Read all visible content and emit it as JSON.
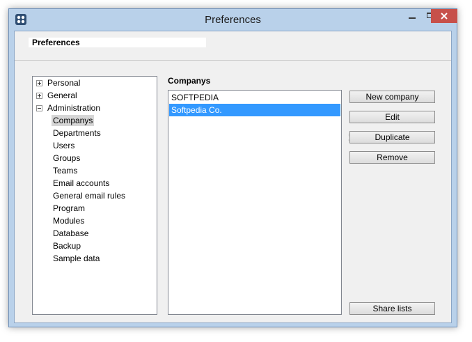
{
  "window": {
    "title": "Preferences",
    "colors": {
      "frame": "#b9d1ea",
      "close": "#c7504a",
      "selection": "#3399ff"
    }
  },
  "icons": [
    "app-icon",
    "minimize-icon",
    "maximize-icon",
    "close-icon",
    "expand-icon",
    "collapse-icon"
  ],
  "header": {
    "title": "Preferences"
  },
  "tree": {
    "nodes": [
      {
        "label": "Personal",
        "expanded": false
      },
      {
        "label": "General",
        "expanded": false
      },
      {
        "label": "Administration",
        "expanded": true
      }
    ],
    "children": [
      "Companys",
      "Departments",
      "Users",
      "Groups",
      "Teams",
      "Email accounts",
      "General email rules",
      "Program",
      "Modules",
      "Database",
      "Backup",
      "Sample data"
    ],
    "selected_child": "Companys"
  },
  "main": {
    "title": "Companys",
    "items": [
      "SOFTPEDIA",
      "Softpedia Co."
    ],
    "selected_item": "Softpedia Co."
  },
  "buttons": {
    "new_company": "New company",
    "edit": "Edit",
    "duplicate": "Duplicate",
    "remove": "Remove",
    "share_lists": "Share lists"
  },
  "watermark": "SOFTPEDIA"
}
